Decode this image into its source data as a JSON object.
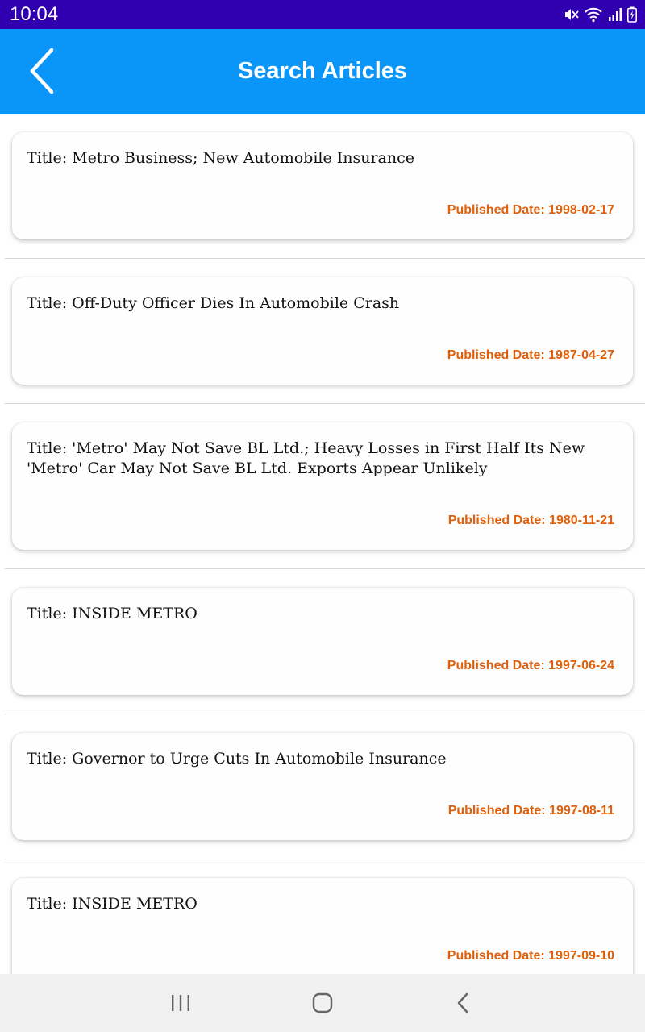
{
  "status_bar": {
    "time": "10:04",
    "icons": [
      "mute-icon",
      "wifi-icon",
      "signal-icon",
      "battery-charging-icon"
    ]
  },
  "app_bar": {
    "title": "Search Articles",
    "back_icon": "chevron-left-icon"
  },
  "articles": [
    {
      "title": "Title: Metro Business; New Automobile Insurance",
      "date": "Published Date: 1998-02-17"
    },
    {
      "title": "Title: Off-Duty Officer Dies In Automobile Crash",
      "date": "Published Date: 1987-04-27"
    },
    {
      "title": "Title: 'Metro' May Not Save BL Ltd.; Heavy Losses in First Half Its New 'Metro' Car May Not Save BL Ltd. Exports Appear Unlikely",
      "date": "Published Date: 1980-11-21"
    },
    {
      "title": "Title: INSIDE METRO",
      "date": "Published Date: 1997-06-24"
    },
    {
      "title": "Title: Governor to Urge Cuts In Automobile Insurance",
      "date": "Published Date: 1997-08-11"
    },
    {
      "title": "Title: INSIDE METRO",
      "date": "Published Date: 1997-09-10"
    }
  ],
  "nav_bar": {
    "icons": [
      "recent-apps-icon",
      "home-icon",
      "back-icon"
    ]
  },
  "colors": {
    "status_bar": "#3000b0",
    "app_bar": "#0a96f8",
    "date_text": "#e0600c",
    "nav_bar": "#f0f0f0"
  }
}
